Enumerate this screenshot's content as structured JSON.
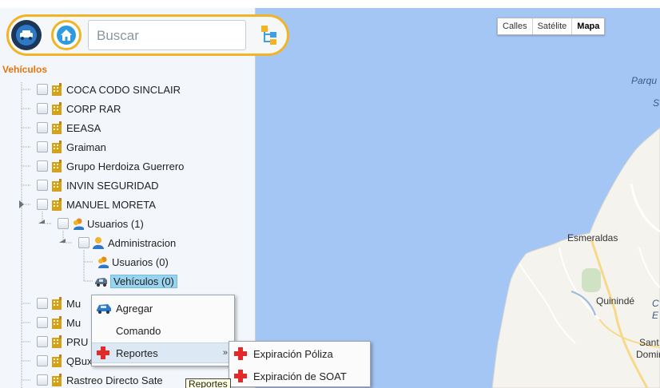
{
  "search": {
    "placeholder": "Buscar"
  },
  "tree": {
    "title": "Vehículos",
    "rows": [
      {
        "label": "COCA CODO SINCLAIR"
      },
      {
        "label": "CORP RAR"
      },
      {
        "label": "EEASA"
      },
      {
        "label": "Graiman"
      },
      {
        "label": "Grupo Herdoiza Guerrero"
      },
      {
        "label": "INVIN SEGURIDAD"
      },
      {
        "label": "MANUEL MORETA"
      },
      {
        "label": "Usuarios (1)"
      },
      {
        "label": "Administracion"
      },
      {
        "label": "Usuarios (0)"
      },
      {
        "label": "Vehículos (0)"
      },
      {
        "label": "Mu"
      },
      {
        "label": "Mu"
      },
      {
        "label": "PRU"
      },
      {
        "label": "QBuxun nucreo"
      },
      {
        "label": "Rastreo Directo Sate"
      }
    ]
  },
  "context_menu": {
    "items": [
      {
        "label": "Agregar"
      },
      {
        "label": "Comando"
      },
      {
        "label": "Reportes",
        "arrow": "»"
      }
    ]
  },
  "submenu": {
    "items": [
      {
        "label": "Expiración Póliza"
      },
      {
        "label": "Expiración de SOAT"
      }
    ]
  },
  "tooltip": "Reportes",
  "map": {
    "types": [
      {
        "label": "Calles"
      },
      {
        "label": "Satélite"
      },
      {
        "label": "Mapa"
      }
    ],
    "labels": {
      "parque": "Parqu",
      "s": "S",
      "esmeraldas": "Esmeraldas",
      "quininde": "Quinindé",
      "c": "C",
      "e": "E",
      "santo": "Sant",
      "domingo": "Domir"
    }
  },
  "colors": {
    "accent": "#f2b324",
    "title": "#e8740c",
    "selection": "#99d3ee",
    "water": "#a4c6f4",
    "land": "#f4f3ee"
  }
}
